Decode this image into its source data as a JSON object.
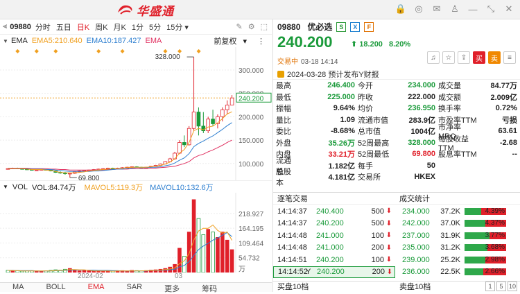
{
  "brand": {
    "logo_text": "华盛通"
  },
  "colors": {
    "up": "#e0202a",
    "down": "#1a9a3a",
    "ema5": "#f0a020",
    "ema10": "#2e7fd0",
    "ema": "#e03060",
    "accent": "#e0202a"
  },
  "chart_toolbar": {
    "symbol": "09880",
    "periods": [
      "分时",
      "五日",
      "日K",
      "周K",
      "月K",
      "1分",
      "5分",
      "15分"
    ],
    "active_period": "日K"
  },
  "ema_row": {
    "label": "EMA",
    "ema5": "EMA5:210.640",
    "ema10": "EMA10:187.427",
    "ema": "EMA",
    "adjust": "前复权"
  },
  "vol_row": {
    "label": "VOL",
    "vol": "VOL:84.74万",
    "mavol5": "MAVOL5:119.3万",
    "mavol10": "MAVOL10:132.6万"
  },
  "chart_data": [
    {
      "type": "candlestick",
      "title": "",
      "price_axis_ticks": [
        300.0,
        250.0,
        200.0,
        150.0,
        100.0
      ],
      "price_labels": [
        "300.000",
        "250.000",
        "200.000",
        "150.000",
        "100.000"
      ],
      "ylim": [
        70,
        340
      ],
      "current_price_label": "240.200",
      "high_annotation": "328.000",
      "low_annotation": "69.800",
      "x_labels": [
        "2024-02",
        "03"
      ],
      "candles": [
        [
          88,
          90,
          87,
          89
        ],
        [
          89,
          91,
          88,
          90
        ],
        [
          90,
          91,
          88,
          89
        ],
        [
          89,
          90,
          87,
          88
        ],
        [
          88,
          89,
          86,
          87
        ],
        [
          87,
          88,
          85,
          86
        ],
        [
          86,
          87,
          84,
          86
        ],
        [
          86,
          88,
          85,
          87
        ],
        [
          87,
          88,
          85,
          86
        ],
        [
          86,
          87,
          83,
          84
        ],
        [
          84,
          85,
          80,
          81
        ],
        [
          81,
          83,
          78,
          80
        ],
        [
          80,
          82,
          76,
          78
        ],
        [
          78,
          80,
          69.8,
          79
        ],
        [
          79,
          83,
          78,
          82
        ],
        [
          82,
          85,
          81,
          84
        ],
        [
          84,
          86,
          82,
          85
        ],
        [
          85,
          87,
          84,
          86
        ],
        [
          86,
          88,
          85,
          87
        ],
        [
          87,
          89,
          86,
          88
        ],
        [
          88,
          90,
          87,
          89
        ],
        [
          89,
          91,
          88,
          90
        ],
        [
          90,
          91,
          88,
          89
        ],
        [
          89,
          91,
          88,
          90
        ],
        [
          90,
          92,
          89,
          91
        ],
        [
          91,
          93,
          90,
          92
        ],
        [
          92,
          94,
          91,
          93
        ],
        [
          93,
          94,
          91,
          92
        ],
        [
          92,
          93,
          90,
          91
        ],
        [
          91,
          93,
          90,
          92
        ],
        [
          92,
          95,
          91,
          94
        ],
        [
          94,
          97,
          93,
          96
        ],
        [
          96,
          100,
          95,
          99
        ],
        [
          99,
          105,
          98,
          104
        ],
        [
          104,
          112,
          103,
          110
        ],
        [
          110,
          125,
          108,
          122
        ],
        [
          122,
          150,
          120,
          145
        ],
        [
          145,
          160,
          135,
          140
        ],
        [
          140,
          180,
          138,
          175
        ],
        [
          175,
          328,
          170,
          210
        ],
        [
          210,
          220,
          160,
          180
        ],
        [
          180,
          210,
          165,
          170
        ],
        [
          170,
          200,
          165,
          195
        ],
        [
          195,
          215,
          180,
          185
        ],
        [
          185,
          205,
          175,
          200
        ],
        [
          200,
          220,
          190,
          215
        ],
        [
          215,
          235,
          205,
          225
        ],
        [
          225,
          246.4,
          225,
          240.2
        ]
      ],
      "ema5": [
        89,
        89,
        89,
        89,
        88,
        87,
        87,
        87,
        86,
        85,
        83,
        81,
        80,
        80,
        80,
        81,
        82,
        84,
        85,
        86,
        87,
        88,
        89,
        89,
        90,
        91,
        92,
        92,
        92,
        92,
        93,
        94,
        96,
        99,
        103,
        110,
        122,
        130,
        145,
        170,
        175,
        172,
        178,
        180,
        187,
        196,
        206,
        210.64
      ],
      "ema10": [
        89,
        89,
        89,
        89,
        89,
        88,
        88,
        88,
        87,
        87,
        86,
        85,
        84,
        83,
        83,
        83,
        83,
        83,
        84,
        84,
        85,
        86,
        87,
        88,
        88,
        89,
        90,
        91,
        91,
        91,
        92,
        92,
        93,
        95,
        97,
        101,
        107,
        112,
        121,
        136,
        143,
        148,
        154,
        159,
        166,
        173,
        181,
        187.43
      ],
      "ema_slow": [
        90,
        90,
        90,
        90,
        90,
        89,
        89,
        89,
        89,
        88,
        88,
        87,
        87,
        86,
        86,
        86,
        86,
        86,
        86,
        86,
        86,
        87,
        87,
        88,
        88,
        88,
        89,
        89,
        89,
        89,
        90,
        90,
        91,
        92,
        93,
        94,
        97,
        100,
        104,
        112,
        117,
        120,
        125,
        129,
        134,
        139,
        145,
        150
      ]
    },
    {
      "type": "bar",
      "title": "",
      "volume_labels": [
        "218.927",
        "164.195",
        "109.464",
        "54.732"
      ],
      "volume_ticks": [
        218.927,
        164.195,
        109.464,
        54.732
      ],
      "unit_label": "万",
      "ylim": [
        0,
        280
      ],
      "volumes": [
        8,
        6,
        7,
        5,
        6,
        7,
        6,
        5,
        6,
        8,
        10,
        9,
        12,
        15,
        8,
        6,
        7,
        6,
        5,
        6,
        5,
        6,
        5,
        6,
        7,
        6,
        8,
        7,
        6,
        7,
        9,
        10,
        12,
        15,
        20,
        30,
        90,
        60,
        150,
        270,
        200,
        140,
        160,
        150,
        130,
        150,
        120,
        84.74
      ],
      "directions": [
        "d",
        "u",
        "d",
        "d",
        "d",
        "d",
        "u",
        "u",
        "d",
        "d",
        "d",
        "d",
        "d",
        "u",
        "u",
        "u",
        "u",
        "u",
        "u",
        "u",
        "u",
        "u",
        "d",
        "u",
        "u",
        "u",
        "u",
        "d",
        "d",
        "u",
        "u",
        "u",
        "u",
        "u",
        "u",
        "u",
        "u",
        "d",
        "u",
        "u",
        "d",
        "d",
        "u",
        "d",
        "u",
        "u",
        "u",
        "u"
      ],
      "mavol5": [
        8,
        7,
        7,
        6,
        6,
        6,
        6,
        6,
        6,
        6,
        7,
        8,
        9,
        11,
        11,
        10,
        10,
        8,
        6,
        6,
        6,
        6,
        5,
        6,
        6,
        6,
        6,
        6,
        6,
        7,
        7,
        8,
        9,
        11,
        13,
        17,
        33,
        43,
        70,
        120,
        154,
        164,
        164,
        176,
        156,
        146,
        150,
        119.3
      ],
      "mavol10": [
        8,
        8,
        7,
        7,
        7,
        7,
        6,
        6,
        6,
        6,
        7,
        7,
        8,
        9,
        9,
        9,
        9,
        9,
        9,
        8,
        8,
        8,
        7,
        7,
        6,
        6,
        6,
        6,
        6,
        6,
        7,
        7,
        8,
        9,
        10,
        12,
        21,
        26,
        40,
        63,
        85,
        98,
        108,
        120,
        128,
        138,
        148,
        132.6
      ]
    }
  ],
  "bottom_tabs": [
    "MA",
    "BOLL",
    "EMA",
    "SAR",
    "更多",
    "筹码"
  ],
  "active_bottom_tab": "EMA",
  "quote": {
    "code": "09880",
    "name": "优必选",
    "badges": [
      "S",
      "X",
      "F"
    ],
    "price": "240.200",
    "change": "18.200",
    "change_pct": "8.20%",
    "status": "交易中",
    "time": "03-18 14:14",
    "notice": "2024-03-28 预计发布Y财报",
    "buttons": {
      "buy": "买",
      "sell": "卖"
    }
  },
  "quote_table": [
    [
      {
        "l": "最高",
        "v": "246.400",
        "c": "green"
      },
      {
        "l": "今开",
        "v": "234.000",
        "c": "green"
      },
      {
        "l": "成交量",
        "v": "84.77万",
        "c": "dark"
      }
    ],
    [
      {
        "l": "最低",
        "v": "225.000",
        "c": "green"
      },
      {
        "l": "昨收",
        "v": "222.000",
        "c": "dark"
      },
      {
        "l": "成交额",
        "v": "2.009亿",
        "c": "dark"
      }
    ],
    [
      {
        "l": "振幅",
        "v": "9.64%",
        "c": "dark"
      },
      {
        "l": "均价",
        "v": "236.950",
        "c": "green"
      },
      {
        "l": "换手率",
        "v": "0.72%",
        "c": "dark"
      }
    ],
    [
      {
        "l": "量比",
        "v": "1.09",
        "c": "dark"
      },
      {
        "l": "流通市值",
        "v": "283.9亿",
        "c": "dark"
      },
      {
        "l": "市盈率TTM",
        "v": "亏损",
        "c": "dark"
      }
    ],
    [
      {
        "l": "委比",
        "v": "-8.68%",
        "c": "dark"
      },
      {
        "l": "总市值",
        "v": "1004亿",
        "c": "dark"
      },
      {
        "l": "市净率MRQ",
        "v": "63.61",
        "c": "dark"
      }
    ],
    [
      {
        "l": "外盘",
        "v": "35.26万",
        "c": "green"
      },
      {
        "l": "52周最高",
        "v": "328.000",
        "c": "green"
      },
      {
        "l": "每股收益TTM",
        "v": "-2.68",
        "c": "dark"
      }
    ],
    [
      {
        "l": "内盘",
        "v": "33.21万",
        "c": "red"
      },
      {
        "l": "52周最低",
        "v": "69.800",
        "c": "red"
      },
      {
        "l": "股息率TTM",
        "v": "--",
        "c": "dark"
      }
    ],
    [
      {
        "l": "流通股",
        "v": "1.182亿",
        "c": "dark"
      },
      {
        "l": "每手",
        "v": "50",
        "c": "dark"
      },
      {
        "l": "",
        "v": "",
        "c": "dark"
      }
    ],
    [
      {
        "l": "总股本",
        "v": "4.181亿",
        "c": "dark"
      },
      {
        "l": "交易所",
        "v": "HKEX",
        "c": "dark"
      },
      {
        "l": "",
        "v": "",
        "c": "dark"
      }
    ]
  ],
  "sections": {
    "ticks_title": "逐笔交易",
    "deals_title": "成交统计",
    "bid_title": "买盘10档",
    "ask_title": "卖盘10档"
  },
  "ticks": [
    {
      "time": "14:14:37",
      "price": "240.400",
      "vol": "500"
    },
    {
      "time": "14:14:37",
      "price": "240.200",
      "vol": "500"
    },
    {
      "time": "14:14:48",
      "price": "241.000",
      "vol": "100"
    },
    {
      "time": "14:14:48",
      "price": "241.000",
      "vol": "200"
    },
    {
      "time": "14:14:51",
      "price": "240.200",
      "vol": "100"
    },
    {
      "time": "14:14:52",
      "flag": "Y",
      "price": "240.200",
      "vol": "200"
    }
  ],
  "deals": [
    {
      "price": "234.000",
      "vol": "37.2K",
      "pct": "4.39%",
      "p": 0.4
    },
    {
      "price": "242.000",
      "vol": "37.0K",
      "pct": "4.37%",
      "p": 0.5
    },
    {
      "price": "237.000",
      "vol": "31.9K",
      "pct": "3.77%",
      "p": 0.6
    },
    {
      "price": "235.000",
      "vol": "31.2K",
      "pct": "3.68%",
      "p": 0.55
    },
    {
      "price": "239.000",
      "vol": "25.2K",
      "pct": "2.98%",
      "p": 0.5
    },
    {
      "price": "236.000",
      "vol": "22.5K",
      "pct": "2.66%",
      "p": 0.45
    }
  ],
  "pager": [
    "1",
    "5",
    "10"
  ]
}
